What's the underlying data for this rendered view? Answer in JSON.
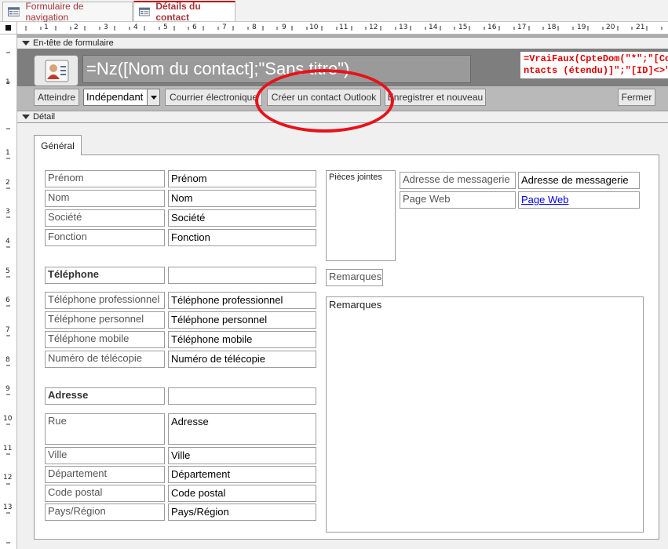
{
  "tabs": [
    {
      "label": "Formulaire de navigation",
      "active": false
    },
    {
      "label": "Détails du contact",
      "active": true
    }
  ],
  "ruler": {
    "h": [
      "1",
      "2",
      "3",
      "4",
      "5",
      "6",
      "7",
      "8",
      "9",
      "10",
      "11",
      "12",
      "13",
      "14",
      "15",
      "16",
      "17",
      "18",
      "19",
      "20",
      "21"
    ],
    "v_top": [
      "1"
    ],
    "v_detail": [
      "1",
      "2",
      "3",
      "4",
      "5",
      "6",
      "7",
      "8",
      "9",
      "10",
      "11",
      "12",
      "13"
    ]
  },
  "form_header": {
    "section_label": "En-tête de formulaire",
    "title_expression": "=Nz([Nom du contact];\"Sans titre\")",
    "visibility_expression_line1": "=VraiFaux(CpteDom(\"*\";\"[Co",
    "visibility_expression_line2": "ntacts (étendu)]\";\"[ID]<>\" &",
    "buttons": {
      "goto": "Atteindre",
      "combo_value": "Indépendant",
      "email": "Courrier électronique",
      "outlook": "Créer un contact Outlook",
      "save_new": "Enregistrer et nouveau",
      "close": "Fermer"
    }
  },
  "detail": {
    "section_label": "Détail",
    "tab_page": "Général",
    "fields": {
      "prenom": {
        "label": "Prénom",
        "value": "Prénom"
      },
      "nom": {
        "label": "Nom",
        "value": "Nom"
      },
      "societe": {
        "label": "Société",
        "value": "Société"
      },
      "fonction": {
        "label": "Fonction",
        "value": "Fonction"
      },
      "telephone_heading": "Téléphone",
      "tel_pro": {
        "label": "Téléphone professionnel",
        "value": "Téléphone professionnel"
      },
      "tel_perso": {
        "label": "Téléphone personnel",
        "value": "Téléphone personnel"
      },
      "tel_mobile": {
        "label": "Téléphone mobile",
        "value": "Téléphone mobile"
      },
      "fax": {
        "label": "Numéro de télécopie",
        "value": "Numéro de télécopie"
      },
      "adresse_heading": "Adresse",
      "rue": {
        "label": "Rue",
        "value": "Adresse"
      },
      "ville": {
        "label": "Ville",
        "value": "Ville"
      },
      "departement": {
        "label": "Département",
        "value": "Département"
      },
      "code_postal": {
        "label": "Code postal",
        "value": "Code postal"
      },
      "pays": {
        "label": "Pays/Région",
        "value": "Pays/Région"
      },
      "pieces_jointes": "Pièces jointes",
      "email": {
        "label": "Adresse de messagerie",
        "value": "Adresse de messagerie"
      },
      "page_web": {
        "label": "Page Web",
        "value": "Page Web"
      },
      "remarques_label": "Remarques",
      "remarques_value": "Remarques"
    }
  },
  "colors": {
    "tab_text": "#a4373a",
    "annotation": "#e8121a",
    "expression": "#e00000",
    "link": "#0000ee"
  }
}
